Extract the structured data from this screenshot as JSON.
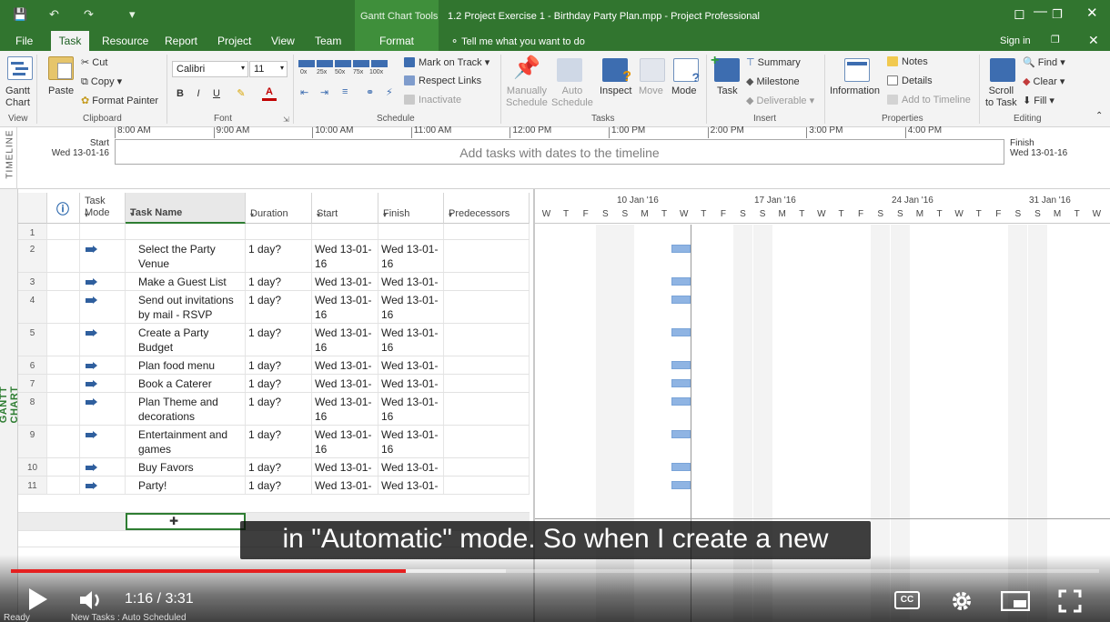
{
  "titlebar": {
    "context_tab": "Gantt Chart Tools",
    "document_title": "1.2 Project Exercise 1 - Birthday Party Plan.mpp - Project Professional"
  },
  "tabs": [
    "File",
    "Task",
    "Resource",
    "Report",
    "Project",
    "View",
    "Team",
    "Format"
  ],
  "tell_me": "Tell me what you want to do",
  "sign_in": "Sign in",
  "ribbon": {
    "view": {
      "gantt_label": "Gantt\nChart",
      "group": "View"
    },
    "clipboard": {
      "paste": "Paste",
      "cut": "Cut",
      "copy": "Copy",
      "format_painter": "Format Painter",
      "group": "Clipboard"
    },
    "font": {
      "name": "Calibri",
      "size": "11",
      "bold": "B",
      "italic": "I",
      "underline": "U",
      "group": "Font"
    },
    "schedule": {
      "mark_on_track": "Mark on Track",
      "respect_links": "Respect Links",
      "inactivate": "Inactivate",
      "pct": [
        "0x",
        "25x",
        "50x",
        "75x",
        "100x"
      ],
      "group": "Schedule"
    },
    "tasks": {
      "manual": "Manually\nSchedule",
      "auto": "Auto\nSchedule",
      "inspect": "Inspect",
      "move": "Move",
      "mode": "Mode",
      "group": "Tasks"
    },
    "insert": {
      "task": "Task",
      "summary": "Summary",
      "milestone": "Milestone",
      "deliverable": "Deliverable",
      "group": "Insert"
    },
    "properties": {
      "information": "Information",
      "notes": "Notes",
      "details": "Details",
      "add_to_timeline": "Add to Timeline",
      "group": "Properties"
    },
    "editing": {
      "scroll": "Scroll\nto Task",
      "find": "Find",
      "clear": "Clear",
      "fill": "Fill",
      "group": "Editing"
    }
  },
  "timeline": {
    "label": "TIMELINE",
    "start_label": "Start",
    "start_date": "Wed 13-01-16",
    "finish_label": "Finish",
    "finish_date": "Wed 13-01-16",
    "message": "Add tasks with dates to the timeline",
    "ticks": [
      "8:00 AM",
      "9:00 AM",
      "10:00 AM",
      "11:00 AM",
      "12:00 PM",
      "1:00 PM",
      "2:00 PM",
      "3:00 PM",
      "4:00 PM"
    ]
  },
  "gantt": {
    "side_label": "GANTT CHART",
    "columns": {
      "mode": "Task\nMode",
      "name": "Task Name",
      "duration": "Duration",
      "start": "Start",
      "finish": "Finish",
      "predecessors": "Predecessors"
    },
    "rows": [
      {
        "id": "1",
        "name": "",
        "duration": "",
        "start": "",
        "finish": ""
      },
      {
        "id": "2",
        "name": "Select the Party Venue",
        "duration": "1 day?",
        "start": "Wed 13-01-16",
        "finish": "Wed 13-01-16"
      },
      {
        "id": "3",
        "name": "Make a Guest List",
        "duration": "1 day?",
        "start": "Wed 13-01-1",
        "finish": "Wed 13-01-1"
      },
      {
        "id": "4",
        "name": "Send out invitations by mail - RSVP",
        "duration": "1 day?",
        "start": "Wed 13-01-16",
        "finish": "Wed 13-01-16"
      },
      {
        "id": "5",
        "name": "Create a Party Budget",
        "duration": "1 day?",
        "start": "Wed 13-01-16",
        "finish": "Wed 13-01-16"
      },
      {
        "id": "6",
        "name": "Plan food menu",
        "duration": "1 day?",
        "start": "Wed 13-01-1",
        "finish": "Wed 13-01-1"
      },
      {
        "id": "7",
        "name": "Book a Caterer",
        "duration": "1 day?",
        "start": "Wed 13-01-1",
        "finish": "Wed 13-01-1"
      },
      {
        "id": "8",
        "name": "Plan Theme and decorations",
        "duration": "1 day?",
        "start": "Wed 13-01-16",
        "finish": "Wed 13-01-16"
      },
      {
        "id": "9",
        "name": "Entertainment and games",
        "duration": "1 day?",
        "start": "Wed 13-01-16",
        "finish": "Wed 13-01-16"
      },
      {
        "id": "10",
        "name": "Buy Favors",
        "duration": "1 day?",
        "start": "Wed 13-01-1",
        "finish": "Wed 13-01-1"
      },
      {
        "id": "11",
        "name": "Party!",
        "duration": "1 day?",
        "start": "Wed 13-01-1",
        "finish": "Wed 13-01-1"
      }
    ],
    "weeks": [
      "10 Jan '16",
      "17 Jan '16",
      "24 Jan '16",
      "31 Jan '16"
    ],
    "day_letters": [
      "W",
      "T",
      "F",
      "S",
      "S",
      "M",
      "T",
      "W",
      "T",
      "F",
      "S",
      "S",
      "M",
      "T",
      "W",
      "T",
      "F",
      "S",
      "S",
      "M",
      "T",
      "W",
      "T",
      "F",
      "S",
      "S",
      "M",
      "T",
      "W"
    ]
  },
  "subtitle": "in \"Automatic\" mode. So when I create a new",
  "player": {
    "time": "1:16 / 3:31",
    "played_fraction": 0.363,
    "buffered_fraction": 0.455,
    "cc": "CC"
  },
  "statusbar": {
    "ready": "Ready",
    "new_tasks": "New Tasks : Auto Scheduled"
  }
}
